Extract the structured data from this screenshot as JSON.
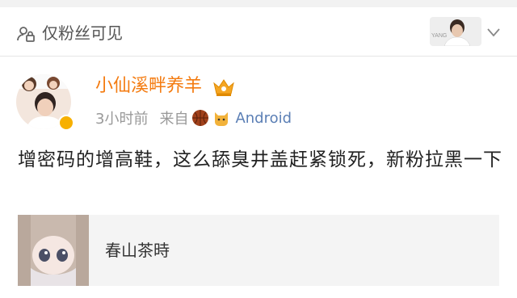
{
  "visibility": {
    "label": "仅粉丝可见",
    "icon": "lock-people-icon",
    "selector_icon": "chevron-down-icon",
    "avatar_watermark": "YANG"
  },
  "post": {
    "author": "小仙溪畔养羊",
    "author_color": "#f47b10",
    "badge_icon": "crown-icon",
    "time": "3小时前",
    "source_prefix": "来自",
    "client_icons": [
      "basketball-icon",
      "cat-icon"
    ],
    "client": "Android",
    "text": "增密码的增高鞋，这么舔臭井盖赶紧锁死，新粉拉黑一下"
  },
  "card": {
    "title": "春山茶時",
    "background": "#f4f4f4"
  },
  "colors": {
    "link": "#5b7fb5",
    "meta": "#999999"
  }
}
